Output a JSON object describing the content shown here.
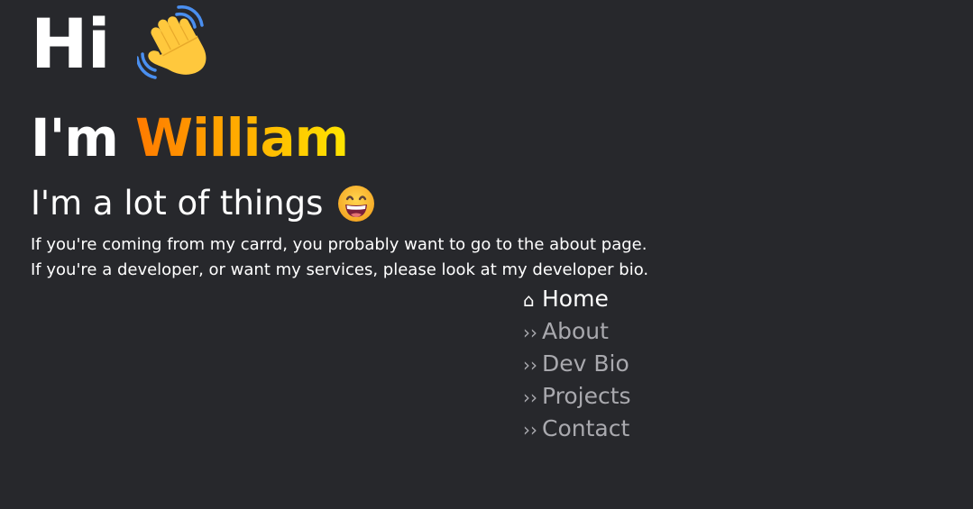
{
  "hero": {
    "greeting": "Hi",
    "wave_icon": "waving-hand-icon",
    "intro_prefix": "I'm ",
    "name": "William",
    "tagline": "I'm a lot of things",
    "tagline_icon": "grinning-face-icon"
  },
  "intro": {
    "line1": "If you're coming from my carrd, you probably want to go to the about page.",
    "line2": "If you're a developer, or want my services, please look at my developer bio."
  },
  "nav": {
    "items": [
      {
        "symbol": "⌂",
        "label": "Home",
        "active": true,
        "icon": "home-icon"
      },
      {
        "symbol": "››",
        "label": "About",
        "active": false,
        "icon": "double-chevron-icon"
      },
      {
        "symbol": "››",
        "label": "Dev Bio",
        "active": false,
        "icon": "double-chevron-icon"
      },
      {
        "symbol": "››",
        "label": "Projects",
        "active": false,
        "icon": "double-chevron-icon"
      },
      {
        "symbol": "››",
        "label": "Contact",
        "active": false,
        "icon": "double-chevron-icon"
      }
    ]
  },
  "colors": {
    "background": "#27282c",
    "text": "#ffffff",
    "muted": "#a9a9ae",
    "name_gradient_start": "#ff7a00",
    "name_gradient_end": "#ffe600"
  }
}
